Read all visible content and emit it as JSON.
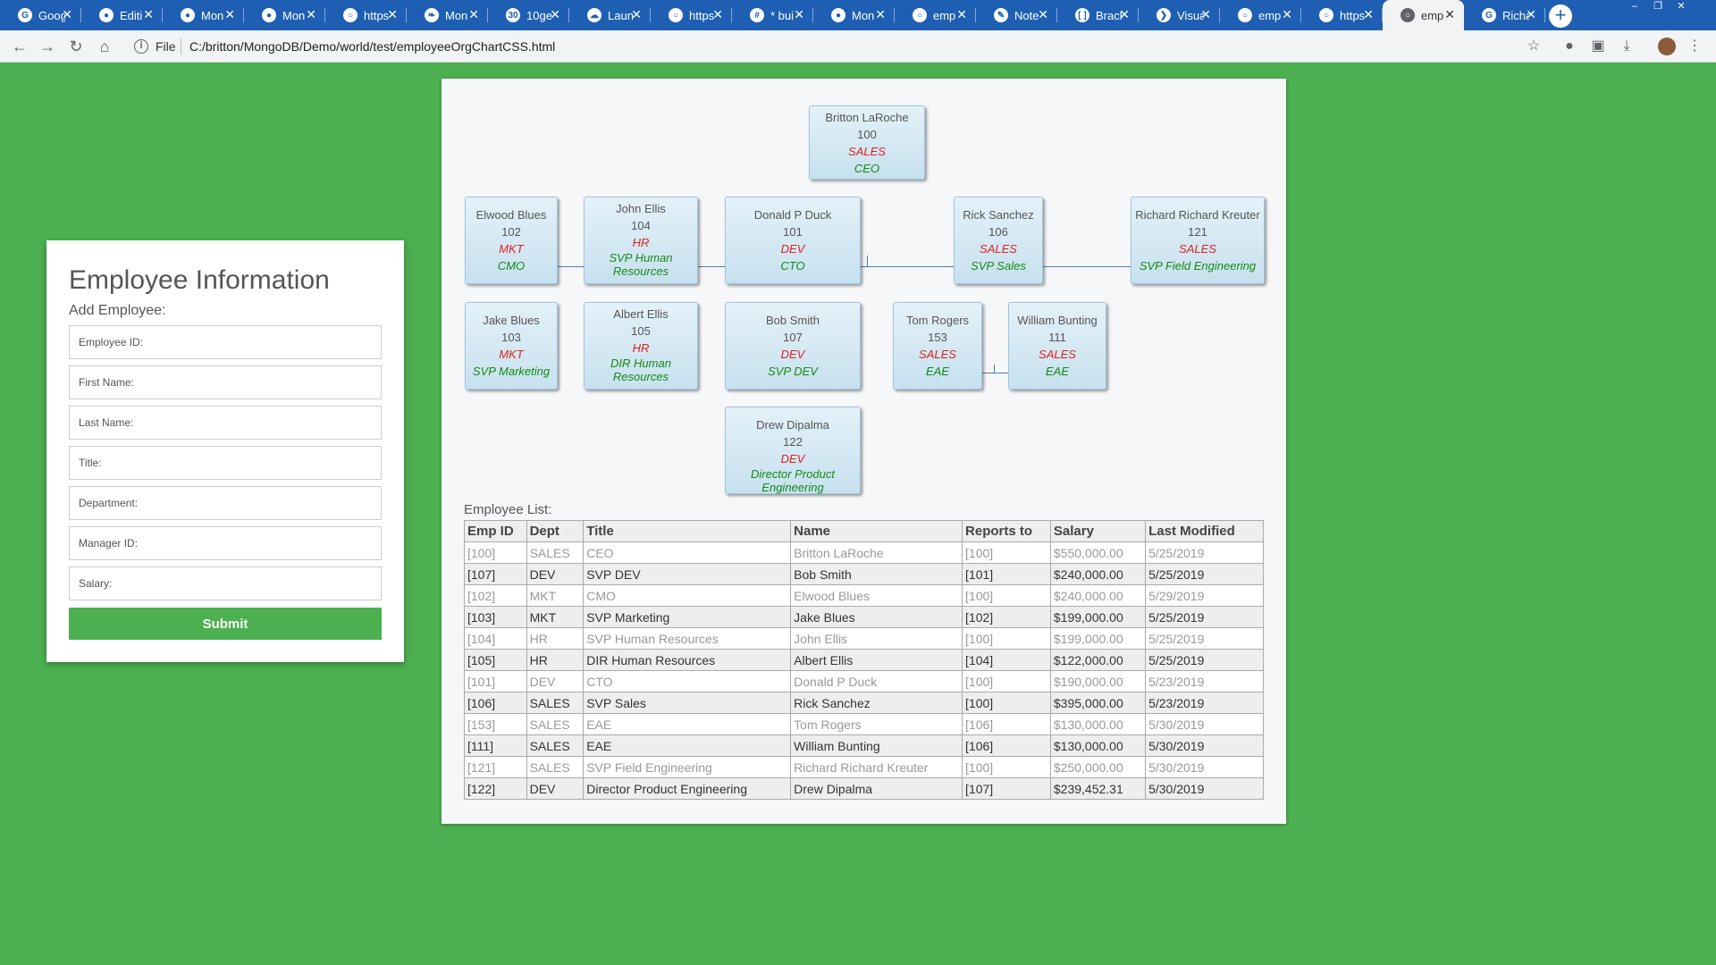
{
  "browser": {
    "tabs": [
      {
        "title": "Goog",
        "icon": "google-docs-icon",
        "active": false
      },
      {
        "title": "Editi",
        "icon": "github-icon",
        "active": false
      },
      {
        "title": "Mon",
        "icon": "github-icon",
        "active": false
      },
      {
        "title": "Mon",
        "icon": "github-icon",
        "active": false
      },
      {
        "title": "https",
        "icon": "globe-icon",
        "active": false
      },
      {
        "title": "Mon",
        "icon": "mongodb-leaf-icon",
        "active": false
      },
      {
        "title": "10ge",
        "icon": "calendar-icon",
        "active": false
      },
      {
        "title": "Laun",
        "icon": "cloud-icon",
        "active": false
      },
      {
        "title": "https",
        "icon": "globe-icon",
        "active": false
      },
      {
        "title": "* bui",
        "icon": "slack-icon",
        "active": false
      },
      {
        "title": "Mon",
        "icon": "github-icon",
        "active": false
      },
      {
        "title": "emp",
        "icon": "globe-icon",
        "active": false
      },
      {
        "title": "Note",
        "icon": "notepad-icon",
        "active": false
      },
      {
        "title": "Brack",
        "icon": "brackets-icon",
        "active": false
      },
      {
        "title": "Visua",
        "icon": "vscode-icon",
        "active": false
      },
      {
        "title": "emp",
        "icon": "globe-icon",
        "active": false
      },
      {
        "title": "https",
        "icon": "globe-icon",
        "active": false
      },
      {
        "title": "emp",
        "icon": "globe-icon",
        "active": true
      },
      {
        "title": "Richa",
        "icon": "google-icon",
        "active": false
      }
    ],
    "scheme_label": "File",
    "url": "C:/britton/MongoDB/Demo/world/test/employeeOrgChartCSS.html"
  },
  "form": {
    "title": "Employee Information",
    "subtitle": "Add Employee:",
    "employee_id_placeholder": "Employee ID:",
    "first_name_placeholder": "First Name:",
    "last_name_placeholder": "Last Name:",
    "title_placeholder": "Title:",
    "department_placeholder": "Department:",
    "manager_id_placeholder": "Manager ID:",
    "salary_placeholder": "Salary:",
    "submit_label": "Submit"
  },
  "orgchart": {
    "nodes": [
      {
        "name": "Britton LaRoche",
        "id": "100",
        "dept": "SALES",
        "title": "CEO"
      },
      {
        "name": "Elwood Blues",
        "id": "102",
        "dept": "MKT",
        "title": "CMO"
      },
      {
        "name": "John Ellis",
        "id": "104",
        "dept": "HR",
        "title": "SVP Human Resources"
      },
      {
        "name": "Donald P Duck",
        "id": "101",
        "dept": "DEV",
        "title": "CTO"
      },
      {
        "name": "Rick Sanchez",
        "id": "106",
        "dept": "SALES",
        "title": "SVP Sales"
      },
      {
        "name": "Richard Richard Kreuter",
        "id": "121",
        "dept": "SALES",
        "title": "SVP Field Engineering"
      },
      {
        "name": "Jake Blues",
        "id": "103",
        "dept": "MKT",
        "title": "SVP Marketing"
      },
      {
        "name": "Albert Ellis",
        "id": "105",
        "dept": "HR",
        "title": "DIR Human Resources"
      },
      {
        "name": "Bob Smith",
        "id": "107",
        "dept": "DEV",
        "title": "SVP DEV"
      },
      {
        "name": "Tom Rogers",
        "id": "153",
        "dept": "SALES",
        "title": "EAE"
      },
      {
        "name": "William Bunting",
        "id": "111",
        "dept": "SALES",
        "title": "EAE"
      },
      {
        "name": "Drew Dipalma",
        "id": "122",
        "dept": "DEV",
        "title": "Director Product Engineering"
      }
    ]
  },
  "employee_list": {
    "label": "Employee List:",
    "columns": [
      "Emp ID",
      "Dept",
      "Title",
      "Name",
      "Reports to",
      "Salary",
      "Last Modified"
    ],
    "rows": [
      [
        "[100]",
        "SALES",
        "CEO",
        "Britton LaRoche",
        "[100]",
        "$550,000.00",
        "5/25/2019"
      ],
      [
        "[107]",
        "DEV",
        "SVP DEV",
        "Bob Smith",
        "[101]",
        "$240,000.00",
        "5/25/2019"
      ],
      [
        "[102]",
        "MKT",
        "CMO",
        "Elwood Blues",
        "[100]",
        "$240,000.00",
        "5/29/2019"
      ],
      [
        "[103]",
        "MKT",
        "SVP Marketing",
        "Jake Blues",
        "[102]",
        "$199,000.00",
        "5/25/2019"
      ],
      [
        "[104]",
        "HR",
        "SVP Human Resources",
        "John Ellis",
        "[100]",
        "$199,000.00",
        "5/25/2019"
      ],
      [
        "[105]",
        "HR",
        "DIR Human Resources",
        "Albert Ellis",
        "[104]",
        "$122,000.00",
        "5/25/2019"
      ],
      [
        "[101]",
        "DEV",
        "CTO",
        "Donald P Duck",
        "[100]",
        "$190,000.00",
        "5/23/2019"
      ],
      [
        "[106]",
        "SALES",
        "SVP Sales",
        "Rick Sanchez",
        "[100]",
        "$395,000.00",
        "5/23/2019"
      ],
      [
        "[153]",
        "SALES",
        "EAE",
        "Tom Rogers",
        "[106]",
        "$130,000.00",
        "5/30/2019"
      ],
      [
        "[111]",
        "SALES",
        "EAE",
        "William Bunting",
        "[106]",
        "$130,000.00",
        "5/30/2019"
      ],
      [
        "[121]",
        "SALES",
        "SVP Field Engineering",
        "Richard Richard Kreuter",
        "[100]",
        "$250,000.00",
        "5/30/2019"
      ],
      [
        "[122]",
        "DEV",
        "Director Product Engineering",
        "Drew Dipalma",
        "[107]",
        "$239,452.31",
        "5/30/2019"
      ]
    ]
  },
  "colors": {
    "page_background": "#4caf50",
    "submit_button": "#4caf50",
    "department_text": "#e02020",
    "title_text": "#138a13",
    "connector_line": "#4a7ab5",
    "tab_strip": "#1e5fb4"
  }
}
